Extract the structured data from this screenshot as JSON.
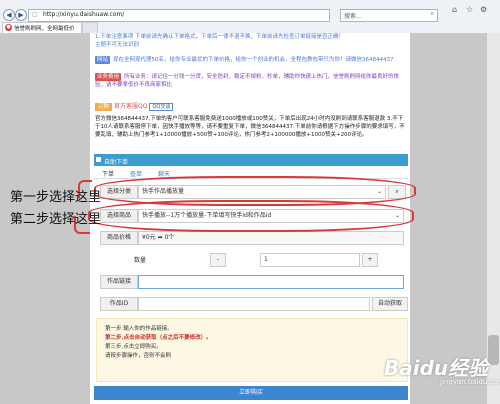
{
  "browser": {
    "url": "http://xinyu.daishuaw.com/",
    "tab_title": "信誉刷刷网，全网最低价",
    "search_placeholder": "搜索..."
  },
  "notices": {
    "n1_text": "1.下单注意事项 下单前请先确认下单格式，下单后一律不退不换，下单前请先检查订单链接是否正确！",
    "n1_text2": "主题不可无法识别",
    "n2_badge": "网站",
    "n2_text": "现在全网现代理50名，给你专业最优的下单价格，给你一个创业的机会，全程包教包带只为你！请微信364844437",
    "n3_badge": "业务费用",
    "n3_text": "所有业务：请记住一分钱一分货，安全防封，稳定不掉粉，秒单，辅助你快速上热门，信誉刷刷网给你最良好的体验，请不要拿低价不良商家相比"
  },
  "qq": {
    "label": "订购",
    "name": "官方客服QQ",
    "button": "QQ交谈"
  },
  "description": "官方微信364844437,下单的客户可联系客服免费送1000播放或100赞关，下单后出现24小时内没刷到请联系客服退款 3.不下于10人请联系客服停下单，因快手播放等等，请不要重复下单，微信364844437.下单前你请根据下方操作步骤的要求填写，不要乱填，辅助上热门参考1+10000播放+500赞+100评论，热门参考2+100000播放+1000赞关+200评论。",
  "panel": {
    "title": "自助下单",
    "tabs": [
      "下单",
      "查单",
      "聊天"
    ]
  },
  "form": {
    "category_label": "选择分类",
    "category_value": "快手作品播放量",
    "product_label": "选择商品",
    "product_value": "快手播放--1万个播放量-下单填写快手id和作品id",
    "price_label": "商品价格",
    "price_value": "¥0元 ➡ 0个",
    "qty_label": "数量",
    "qty_minus": "-",
    "qty_value": "1",
    "qty_plus": "+",
    "link_label": "作品链接",
    "id_label": "作品ID",
    "id_button": "自动获取"
  },
  "tips": {
    "step1": "第一步.输入你的作品链接。",
    "step2": "第二步.点击自动获取（点之后不要修改）。",
    "step3": "第三步.点击立即购买。",
    "step4": "请按步骤操作，否则不会刷"
  },
  "submit_label": "立即购买",
  "annotations": {
    "step1": "第一步选择这里",
    "step2": "第二步选择这里"
  },
  "watermark": "Baidu经验",
  "watermark_sub": "jingyan.baidu.com",
  "colors": {
    "panel_header": "#3d9bd0",
    "submit": "#3b86cc",
    "annotation": "#d83a3a"
  }
}
